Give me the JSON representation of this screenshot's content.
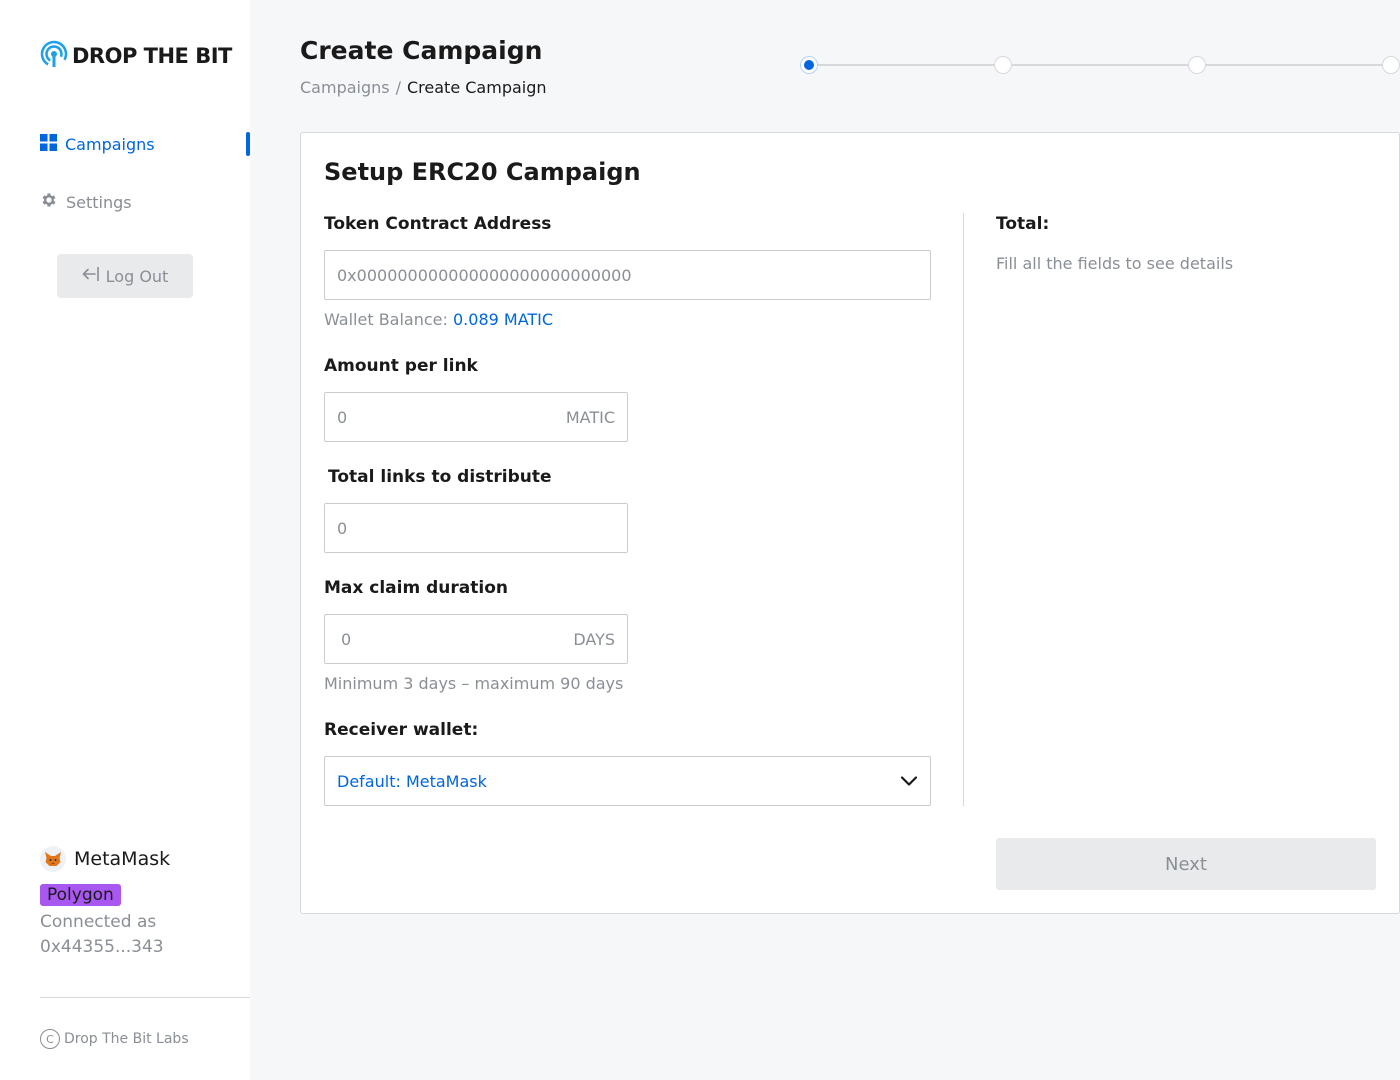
{
  "brand": {
    "name": "DROP THE BIT"
  },
  "nav": {
    "items": [
      {
        "label": "Campaigns",
        "icon": "grid-icon",
        "active": true
      },
      {
        "label": "Settings",
        "icon": "gear-icon",
        "active": false
      }
    ],
    "logout_label": "Log Out"
  },
  "wallet": {
    "name": "MetaMask",
    "network": "Polygon",
    "connected_label": "Connected as",
    "address": "0x44355...343"
  },
  "footer": {
    "text": "Drop The Bit Labs"
  },
  "header": {
    "title": "Create Campaign",
    "breadcrumb": [
      "Campaigns",
      "/",
      "Create Campaign"
    ]
  },
  "stepper": {
    "total_steps": 4,
    "current_step": 1
  },
  "form": {
    "title": "Setup ERC20 Campaign",
    "token_address": {
      "label": "Token Contract Address",
      "placeholder": "0x000000000000000000000000000"
    },
    "wallet_balance": {
      "label": "Wallet Balance:",
      "value": "0.089 MATIC"
    },
    "amount_per_link": {
      "label": "Amount per link",
      "placeholder": "0",
      "suffix": "MATIC"
    },
    "total_links": {
      "label": "Total links to distribute",
      "placeholder": "0"
    },
    "max_claim_duration": {
      "label": "Max claim duration",
      "placeholder": "0",
      "suffix": "DAYS",
      "hint": "Minimum 3 days – maximum 90 days"
    },
    "receiver_wallet": {
      "label": "Receiver wallet:",
      "selected": "Default: MetaMask"
    }
  },
  "summary": {
    "label": "Total:",
    "hint": "Fill all the fields to see details"
  },
  "actions": {
    "next_label": "Next"
  },
  "colors": {
    "accent": "#0066e0",
    "network_badge": "#a857f0",
    "muted": "#8a8f96"
  }
}
